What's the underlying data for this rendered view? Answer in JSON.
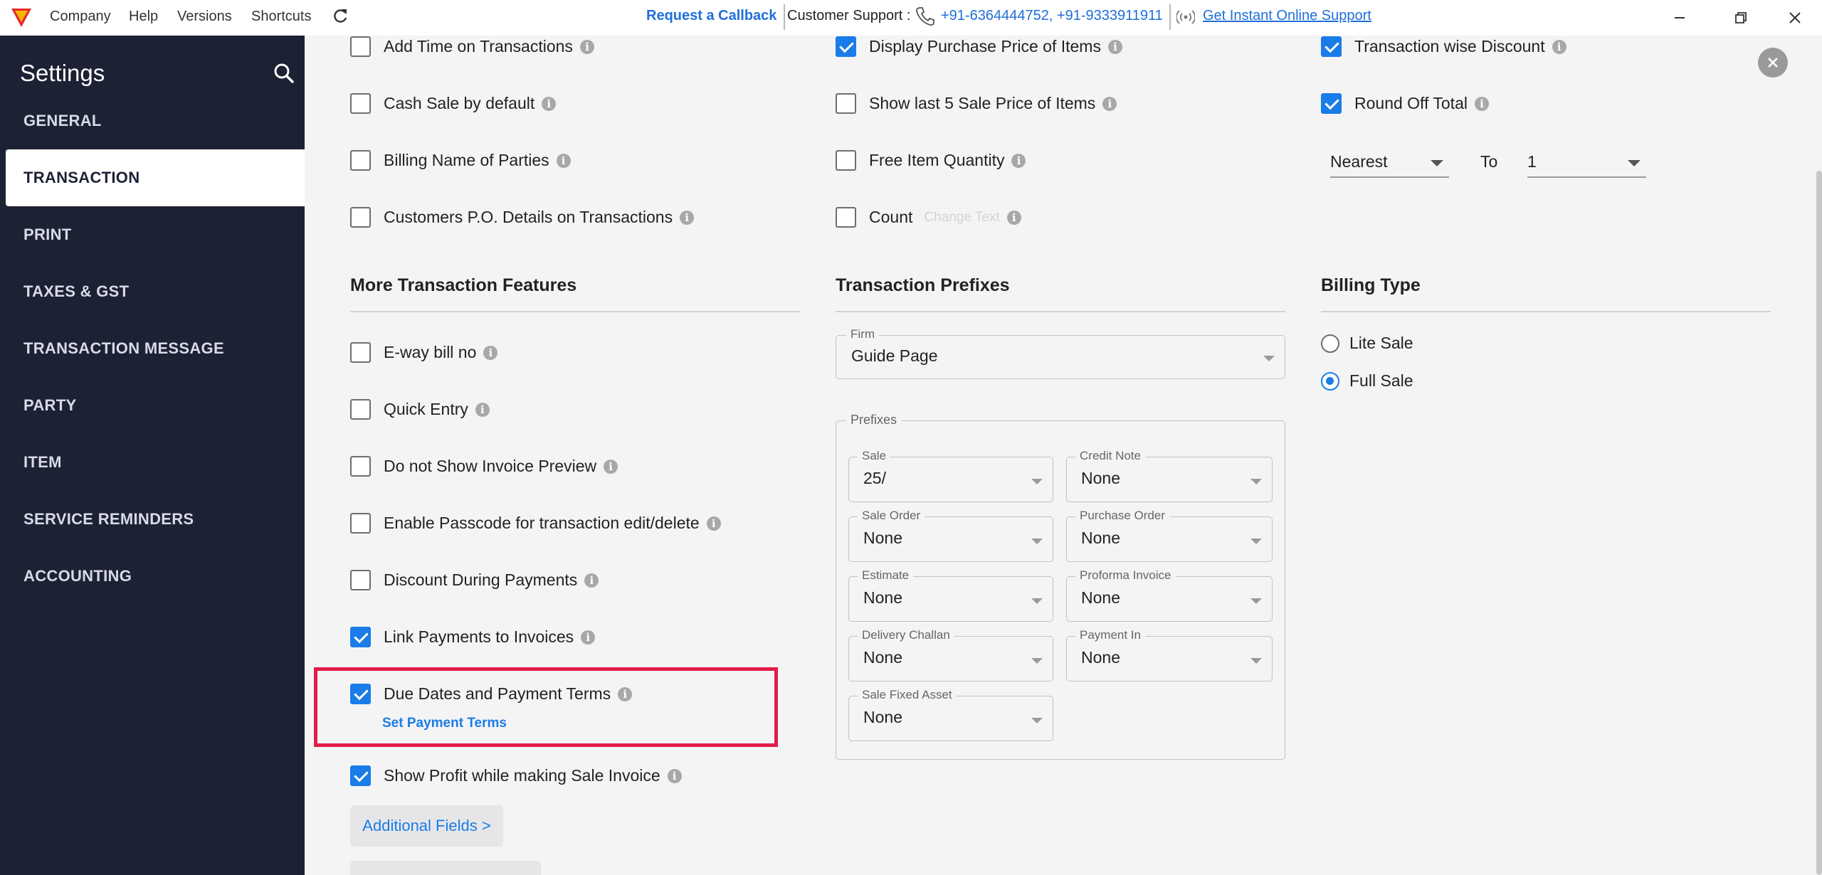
{
  "titlebar": {
    "menu": [
      "Company",
      "Help",
      "Versions",
      "Shortcuts"
    ],
    "callback": "Request a Callback",
    "support_label": "Customer Support :",
    "phones": "+91-6364444752, +91-9333911911",
    "online_support": "Get Instant Online Support"
  },
  "sidebar": {
    "title": "Settings",
    "items": [
      "GENERAL",
      "TRANSACTION",
      "PRINT",
      "TAXES & GST",
      "TRANSACTION MESSAGE",
      "PARTY",
      "ITEM",
      "SERVICE REMINDERS",
      "ACCOUNTING"
    ],
    "active": "TRANSACTION"
  },
  "col1": {
    "top_options": [
      {
        "label": "Add Time on Transactions",
        "checked": false
      },
      {
        "label": "Cash Sale by default",
        "checked": false
      },
      {
        "label": "Billing Name of Parties",
        "checked": false
      },
      {
        "label": "Customers P.O. Details on Transactions",
        "checked": false
      }
    ],
    "section_title": "More Transaction Features",
    "options": [
      {
        "label": "E-way bill no",
        "checked": false
      },
      {
        "label": "Quick Entry",
        "checked": false
      },
      {
        "label": "Do not Show Invoice Preview",
        "checked": false
      },
      {
        "label": "Enable Passcode for transaction edit/delete",
        "checked": false
      },
      {
        "label": "Discount During Payments",
        "checked": false
      },
      {
        "label": "Link Payments to Invoices",
        "checked": true
      },
      {
        "label": "Due Dates and Payment Terms",
        "checked": true
      },
      {
        "label": "Show Profit while making Sale Invoice",
        "checked": true
      }
    ],
    "set_payment_terms": "Set Payment Terms",
    "additional_fields": "Additional Fields >"
  },
  "col2": {
    "top_options": [
      {
        "label": "Display Purchase Price of Items",
        "checked": true
      },
      {
        "label": "Show last 5 Sale Price of Items",
        "checked": false
      },
      {
        "label": "Free Item Quantity",
        "checked": false
      },
      {
        "label": "Count",
        "checked": false
      }
    ],
    "change_text": "Change Text",
    "section_title": "Transaction Prefixes",
    "firm_label": "Firm",
    "firm_value": "Guide Page",
    "prefixes_label": "Prefixes",
    "prefixes": [
      {
        "label": "Sale",
        "value": "25/"
      },
      {
        "label": "Credit Note",
        "value": "None"
      },
      {
        "label": "Sale Order",
        "value": "None"
      },
      {
        "label": "Purchase Order",
        "value": "None"
      },
      {
        "label": "Estimate",
        "value": "None"
      },
      {
        "label": "Proforma Invoice",
        "value": "None"
      },
      {
        "label": "Delivery Challan",
        "value": "None"
      },
      {
        "label": "Payment In",
        "value": "None"
      },
      {
        "label": "Sale Fixed Asset",
        "value": "None"
      }
    ]
  },
  "col3": {
    "top_options": [
      {
        "label": "Transaction wise Discount",
        "checked": true
      },
      {
        "label": "Round Off Total",
        "checked": true
      }
    ],
    "round_mode": "Nearest",
    "to_label": "To",
    "round_to": "1",
    "section_title": "Billing Type",
    "billing_types": [
      {
        "label": "Lite Sale",
        "selected": false
      },
      {
        "label": "Full Sale",
        "selected": true
      }
    ]
  },
  "colors": {
    "accent": "#1a7ce8",
    "sidebar": "#1d2134",
    "highlight": "#e11d48"
  }
}
